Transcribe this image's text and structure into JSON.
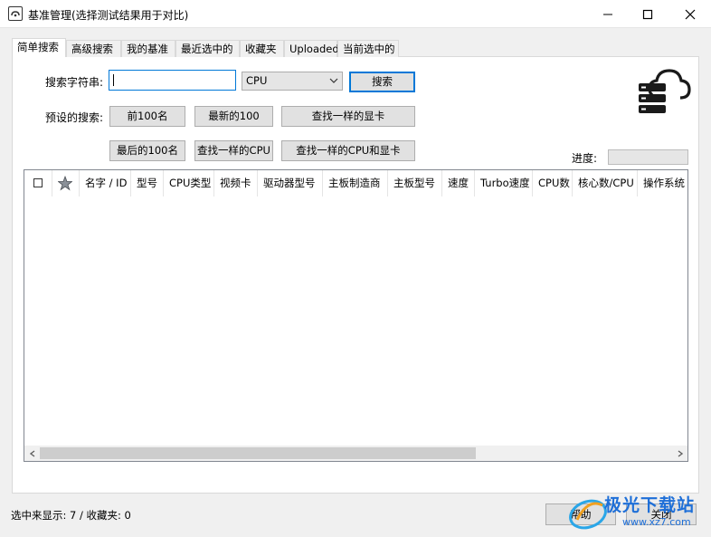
{
  "window": {
    "title": "基准管理(选择测试结果用于对比)"
  },
  "tabs": [
    {
      "label": "简单搜索",
      "active": true
    },
    {
      "label": "高级搜索",
      "active": false
    },
    {
      "label": "我的基准",
      "active": false
    },
    {
      "label": "最近选中的",
      "active": false
    },
    {
      "label": "收藏夹",
      "active": false
    },
    {
      "label": "Uploaded",
      "active": false
    },
    {
      "label": "当前选中的",
      "active": false
    }
  ],
  "search": {
    "string_label": "搜索字符串:",
    "string_value": "",
    "type_selected": "CPU",
    "search_button": "搜索"
  },
  "presets": {
    "label": "预设的搜索:",
    "buttons": [
      "前100名",
      "最新的100",
      "查找一样的显卡",
      "最后的100名",
      "查找一样的CPU",
      "查找一样的CPU和显卡"
    ]
  },
  "progress": {
    "label": "进度:",
    "value": 0
  },
  "grid": {
    "columns": [
      "名字 / ID",
      "型号",
      "CPU类型",
      "视频卡",
      "驱动器型号",
      "主板制造商",
      "主板型号",
      "速度",
      "Turbo速度",
      "CPU数",
      "核心数/CPU",
      "操作系统"
    ],
    "rows": []
  },
  "status": {
    "text": "选中来显示: 7 / 收藏夹: 0"
  },
  "footer": {
    "help_button": "帮助",
    "close_button": "关闭"
  },
  "watermark": {
    "text": "极光下载站",
    "url_text": "www.xz7.com"
  },
  "colors": {
    "accent": "#0078d7",
    "cloud_icon": "#1a1a1a",
    "watermark_blue": "#1e6fd8"
  }
}
